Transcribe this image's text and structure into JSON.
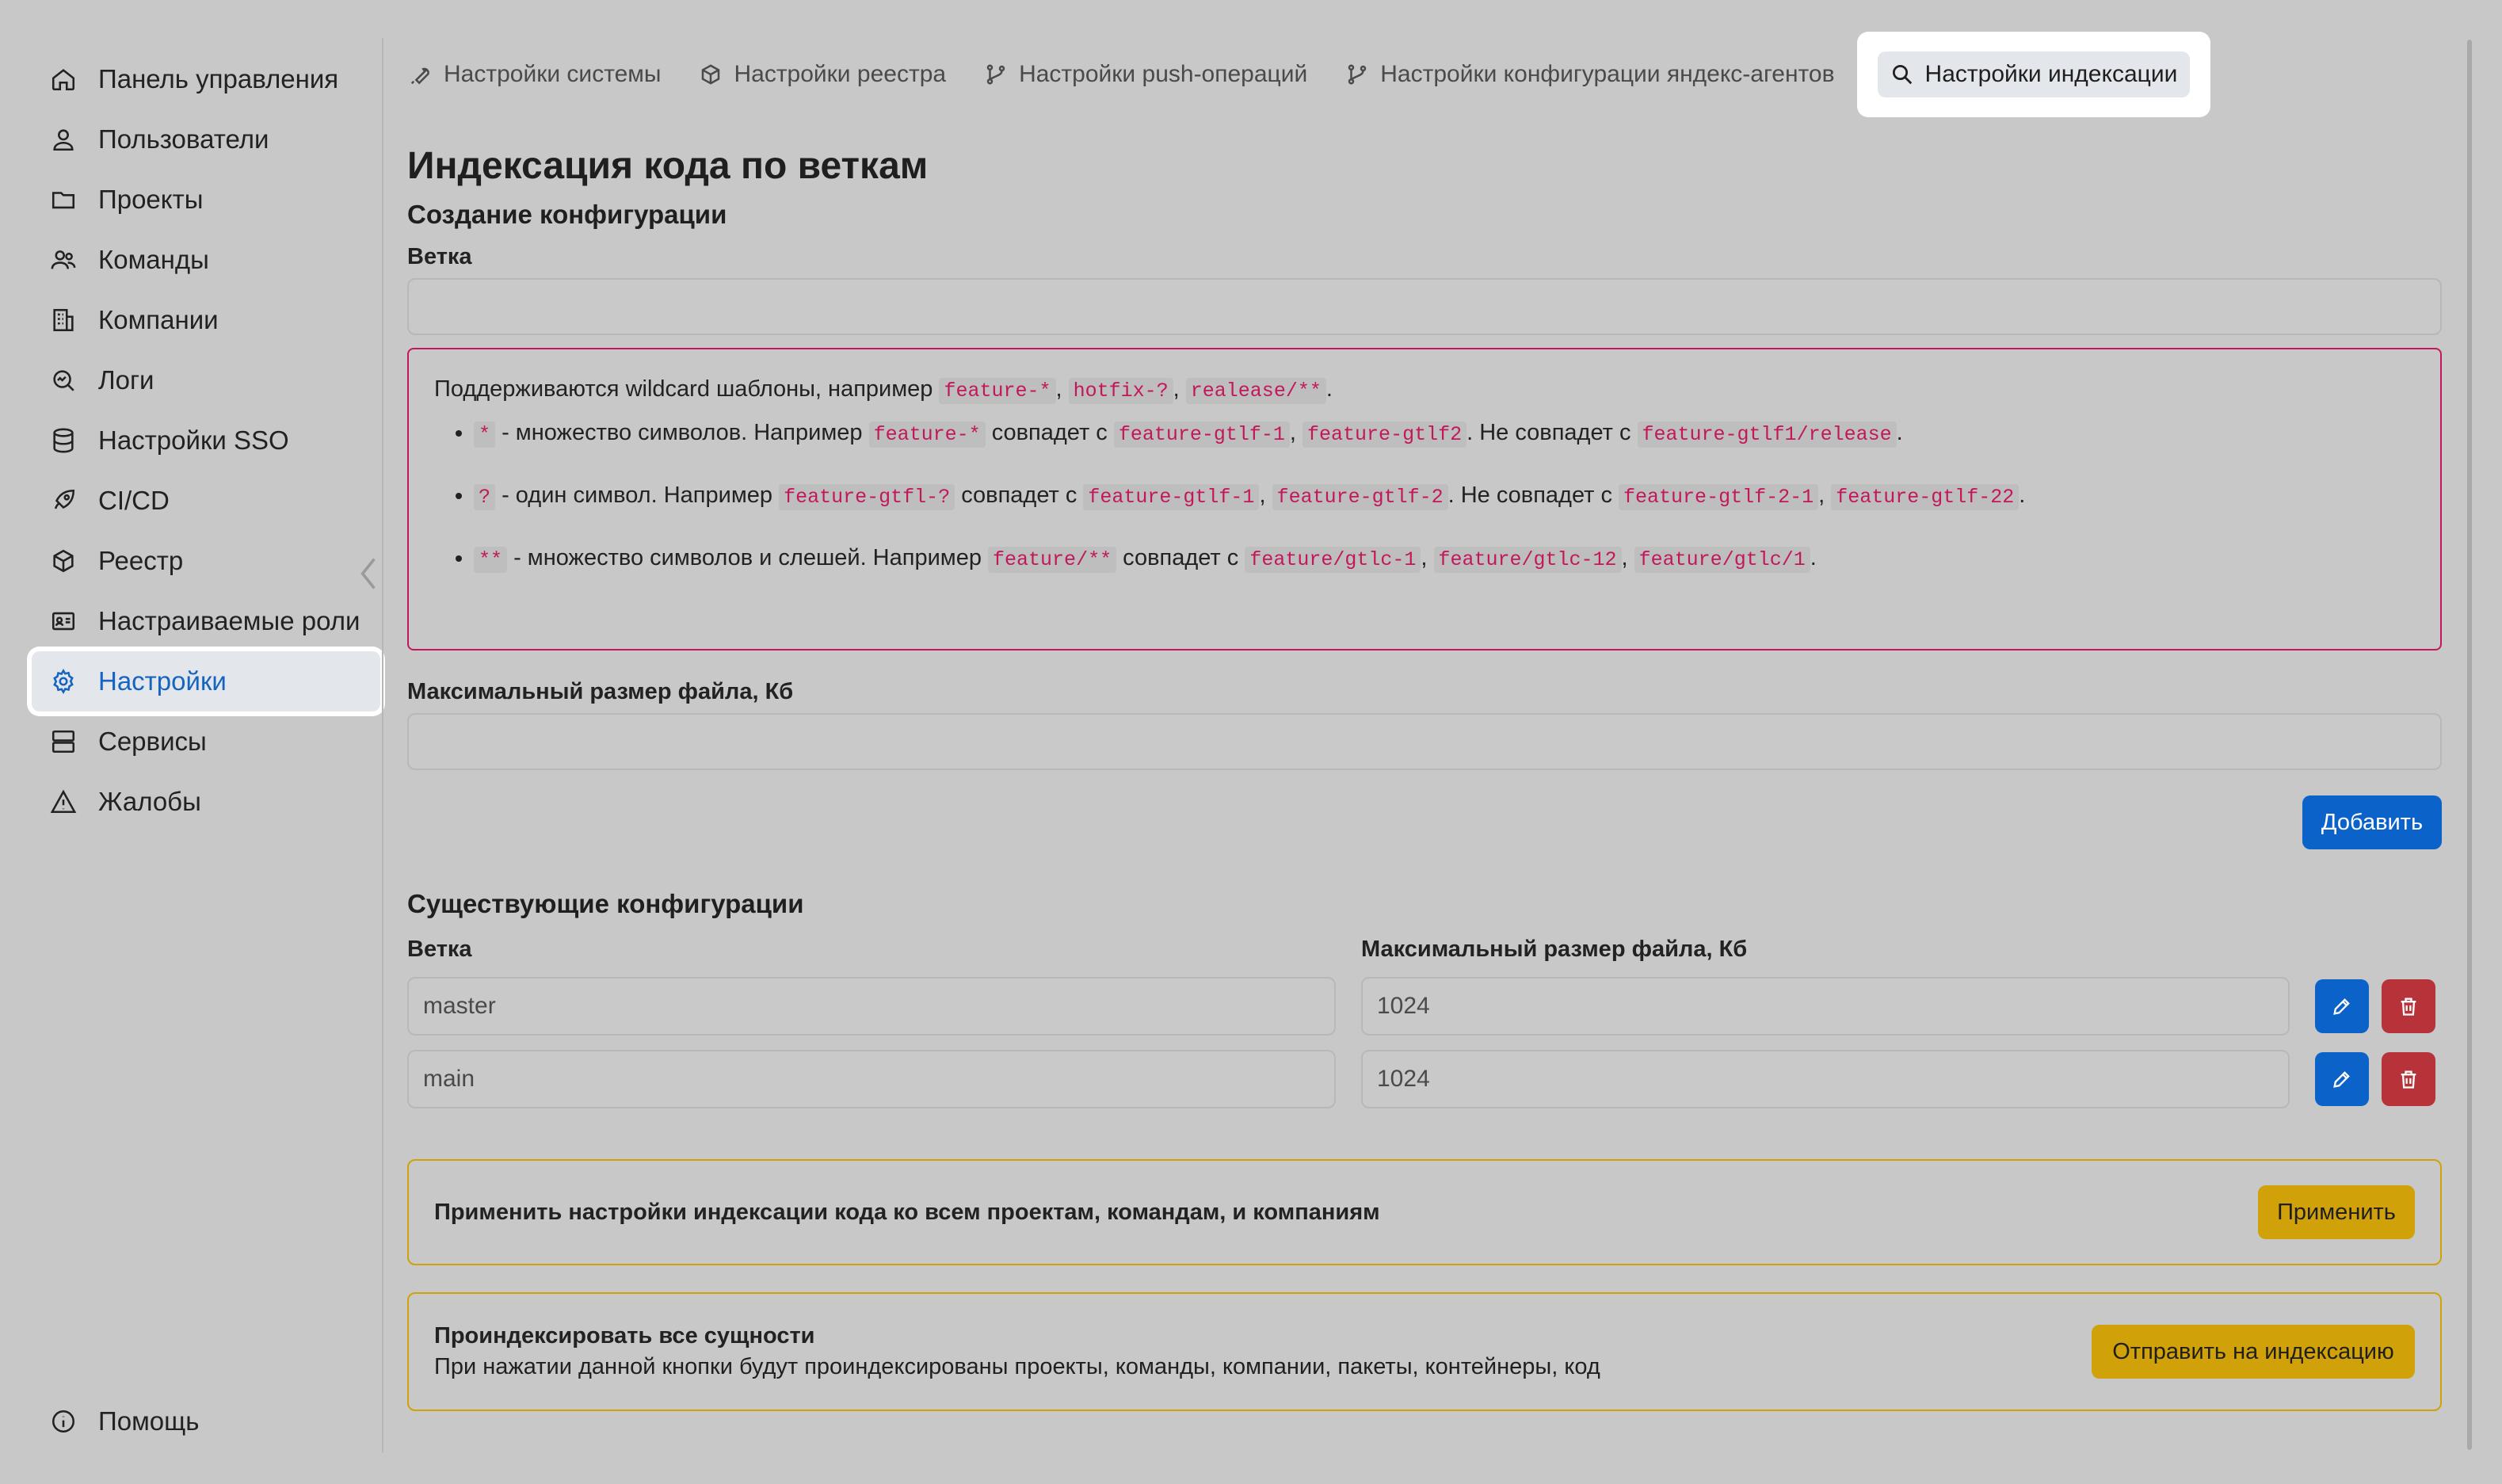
{
  "sidebar": {
    "items": [
      {
        "label": "Панель управления",
        "icon": "home-icon"
      },
      {
        "label": "Пользователи",
        "icon": "user-icon"
      },
      {
        "label": "Проекты",
        "icon": "folder-icon"
      },
      {
        "label": "Команды",
        "icon": "users-icon"
      },
      {
        "label": "Компании",
        "icon": "building-icon"
      },
      {
        "label": "Логи",
        "icon": "log-search-icon"
      },
      {
        "label": "Настройки SSO",
        "icon": "database-icon"
      },
      {
        "label": "CI/CD",
        "icon": "rocket-icon"
      },
      {
        "label": "Реестр",
        "icon": "package-icon"
      },
      {
        "label": "Настраиваемые роли",
        "icon": "id-card-icon"
      },
      {
        "label": "Настройки",
        "icon": "gear-icon",
        "active": true
      },
      {
        "label": "Сервисы",
        "icon": "server-icon"
      },
      {
        "label": "Жалобы",
        "icon": "warning-icon"
      }
    ],
    "help_label": "Помощь",
    "active_color": "#1565c0"
  },
  "tabs": [
    {
      "label": "Настройки системы",
      "icon": "wrench-icon"
    },
    {
      "label": "Настройки реестра",
      "icon": "package-icon"
    },
    {
      "label": "Настройки push-операций",
      "icon": "git-branch-icon"
    },
    {
      "label": "Настройки конфигурации яндекс-агентов",
      "icon": "git-branch-icon"
    },
    {
      "label": "Настройки индексации",
      "icon": "search-icon",
      "active": true
    }
  ],
  "page": {
    "title": "Индексация кода по веткам",
    "create_section": "Создание конфигурации",
    "branch_label": "Ветка",
    "branch_value": "",
    "hint": {
      "intro": "Поддерживаются wildcard шаблоны, например",
      "examples": [
        "feature-*",
        "hotfix-?",
        "realease/**"
      ],
      "rules": [
        {
          "pattern": "*",
          "desc": "- множество символов. Например",
          "example": "feature-*",
          "matches_text": "совпадет с",
          "matches": [
            "feature-gtlf-1",
            "feature-gtlf2"
          ],
          "nomatch_text": ". Не совпадет с",
          "nomatches": [
            "feature-gtlf1/release"
          ]
        },
        {
          "pattern": "?",
          "desc": "- один символ. Например",
          "example": "feature-gtfl-?",
          "matches_text": "совпадет с",
          "matches": [
            "feature-gtlf-1",
            "feature-gtlf-2"
          ],
          "nomatch_text": ". Не совпадет с",
          "nomatches": [
            "feature-gtlf-2-1",
            "feature-gtlf-22"
          ]
        },
        {
          "pattern": "**",
          "desc": "- множество символов и слешей. Например",
          "example": "feature/**",
          "matches_text": "совпадет с",
          "matches": [
            "feature/gtlc-1",
            "feature/gtlc-12",
            "feature/gtlc/1"
          ]
        }
      ]
    },
    "max_size_label": "Максимальный размер файла, Кб",
    "max_size_value": "",
    "add_button": "Добавить",
    "existing_section": "Существующие конфигурации",
    "existing_branch_header": "Ветка",
    "existing_size_header": "Максимальный размер файла, Кб",
    "configs": [
      {
        "branch": "master",
        "size": "1024"
      },
      {
        "branch": "main",
        "size": "1024"
      }
    ],
    "apply_panel": {
      "text": "Применить настройки индексации кода ко всем проектам, командам, и компаниям",
      "button": "Применить"
    },
    "index_panel": {
      "title": "Проиндексировать все сущности",
      "text": "При нажатии данной кнопки будут проиндексированы проекты, команды, компании, пакеты, контейнеры, код",
      "button": "Отправить на индексацию"
    }
  },
  "colors": {
    "primary": "#0b63c9",
    "danger": "#b8323a",
    "warning": "#d1a10a",
    "hint_border": "#c2185b"
  }
}
